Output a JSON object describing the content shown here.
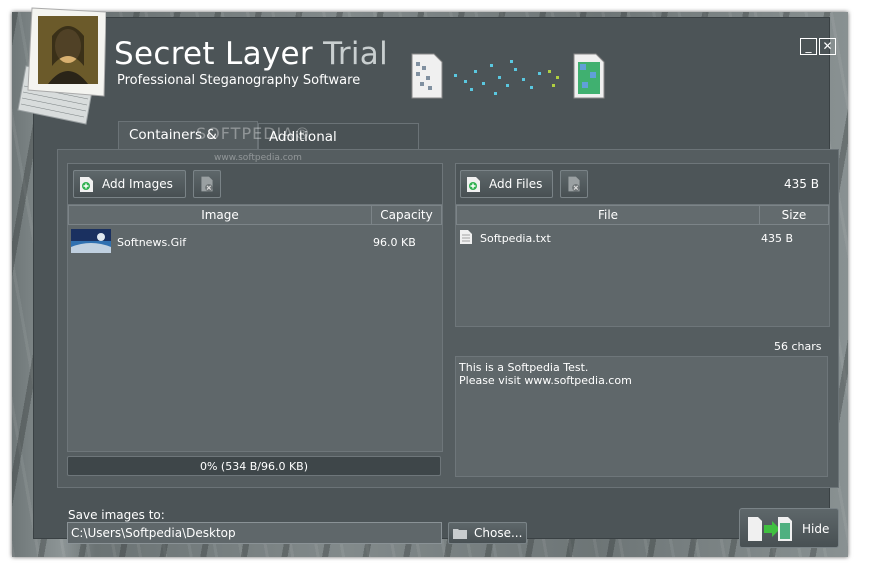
{
  "app": {
    "title_main": "Secret Layer",
    "title_trial": "Trial",
    "subtitle": "Professional Steganography Software",
    "minimize_glyph": "_",
    "close_glyph": "✕"
  },
  "tabs": [
    {
      "label": "Containers & Data",
      "active": true
    },
    {
      "label": "Additional Encryption",
      "active": false
    }
  ],
  "watermark": {
    "text": "SOFTPEDIA®",
    "url": "www.softpedia.com"
  },
  "images_panel": {
    "add_label": "Add Images",
    "remove_icon": "remove-image-icon",
    "columns": [
      "Image",
      "Capacity"
    ],
    "rows": [
      {
        "name": "Softnews.Gif",
        "capacity": "96.0 KB"
      }
    ],
    "progress_text": "0% (534 B/96.0 KB)"
  },
  "files_panel": {
    "add_label": "Add Files",
    "total_size": "435 B",
    "columns": [
      "File",
      "Size"
    ],
    "rows": [
      {
        "name": "Softpedia.txt",
        "size": "435 B"
      }
    ]
  },
  "message": {
    "char_count": "56 chars",
    "line1": "This is a Softpedia Test.",
    "line2": "Please visit www.softpedia.com"
  },
  "save": {
    "label": "Save images to:",
    "path": "C:\\Users\\Softpedia\\Desktop",
    "choose_label": "Chose..."
  },
  "hide_button": {
    "label": "Hide"
  },
  "colors": {
    "accent": "#4c5457",
    "text": "#ffffff",
    "panel": "#4d5558"
  }
}
